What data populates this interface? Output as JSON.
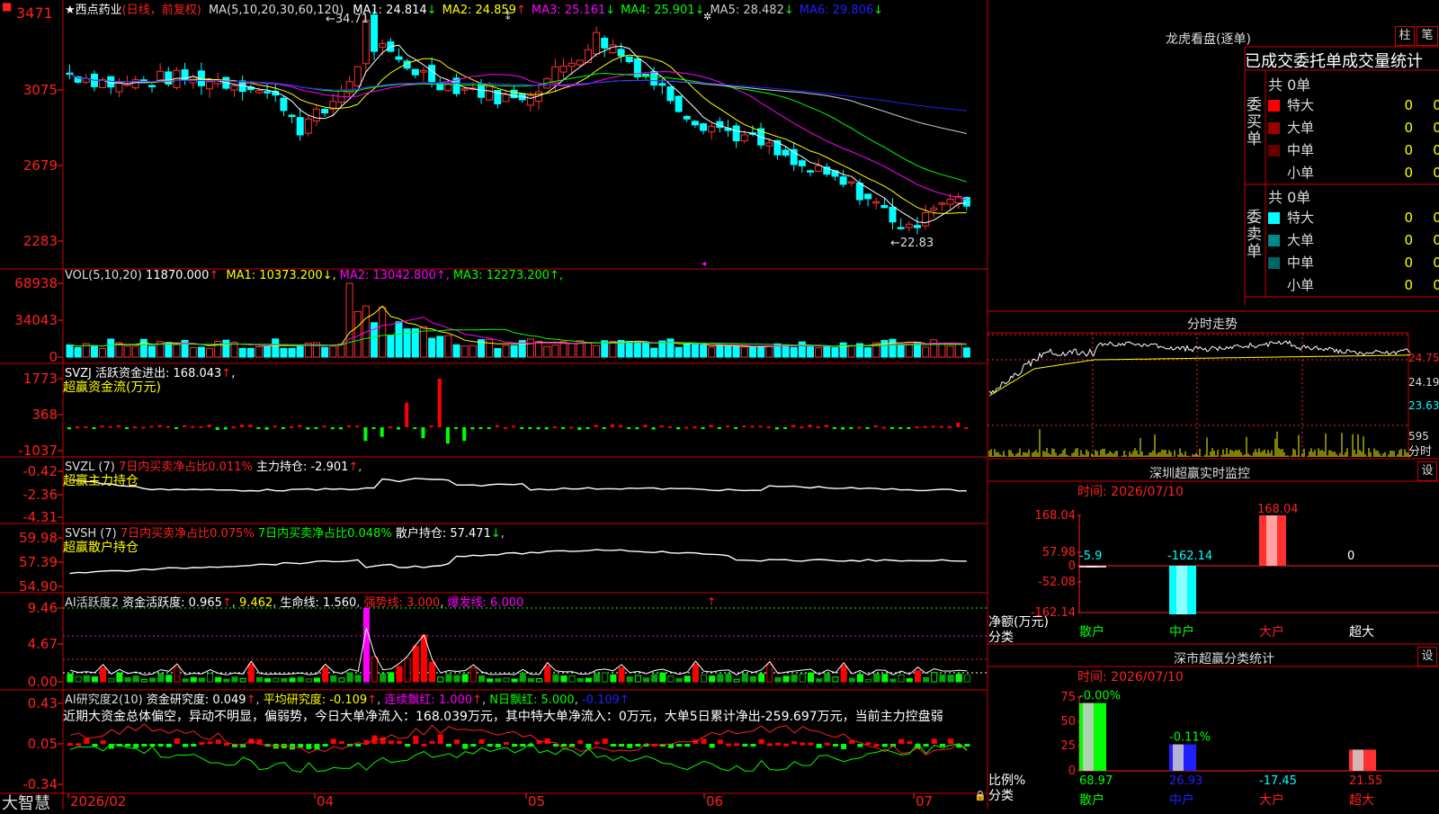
{
  "stock": {
    "name": "西点药业",
    "period": "(日线，前复权)",
    "ma_header": "MA(5,10,20,30,60,120)",
    "ma": [
      {
        "label": "MA1: 24.814",
        "arrow": "↓",
        "color": "#ffffff"
      },
      {
        "label": "MA2: 24.859",
        "arrow": "↑",
        "color": "#ffff00"
      },
      {
        "label": "MA3: 25.161",
        "arrow": "↓",
        "color": "#ff00ff"
      },
      {
        "label": "MA4: 25.901",
        "arrow": "↓",
        "color": "#00ff00"
      },
      {
        "label": "MA5: 28.482",
        "arrow": "↓",
        "color": "#cccccc"
      },
      {
        "label": "MA6: 29.806",
        "arrow": "↓",
        "color": "#2020ff"
      }
    ],
    "price_axis": [
      "3471",
      "3075",
      "2679",
      "2283"
    ],
    "high_label": "34.71",
    "low_label": "←22.83",
    "high_marker": "←"
  },
  "vol": {
    "header": "VOL(5,10,20)",
    "value": "11870.000",
    "ma": [
      {
        "label": "MA1: 10373.200",
        "arrow": "↓",
        "color": "#ffff00"
      },
      {
        "label": "MA2: 13042.800",
        "arrow": "↑",
        "color": "#ff00ff"
      },
      {
        "label": "MA3: 12273.200",
        "arrow": "↑",
        "color": "#00ff00"
      }
    ],
    "axis": [
      "68938",
      "34043",
      "0"
    ]
  },
  "svzj": {
    "header": "SVZJ  活跃资金进出: 168.043",
    "arrow": "↑",
    "sub": "超赢资金流(万元)",
    "axis": [
      "1773",
      "368",
      "-1037"
    ]
  },
  "svzl": {
    "name": "SVZL (7)",
    "part1": "7日内买卖净占比0.011%",
    "part2": "主力持仓: -2.901",
    "arrow": "↑",
    "sub": "超赢主力持仓",
    "axis": [
      "-0.42",
      "-2.36",
      "-4.31"
    ]
  },
  "svsh": {
    "name": "SVSH (7)",
    "part1": "7日内买卖净占比0.075%",
    "part2": "7日内买卖净占比0.048%",
    "part3": "散户持仓: 57.471",
    "arrow": "↓",
    "sub": "超赢散户持仓",
    "axis": [
      "59.98",
      "57.39",
      "54.90"
    ]
  },
  "ai1": {
    "name": "AI活跃度2",
    "t1": "资金活跃度: 0.965",
    "t2": "9.462",
    "t3": "生命线: 1.560",
    "t4": "强势线: 3.000",
    "t5": "爆发线: 6.000",
    "axis": [
      "9.46",
      "4.67",
      "0.00"
    ]
  },
  "ai2": {
    "name": "AI研究度2(10)",
    "t1": "资金研究度: 0.049",
    "t2": "平均研究度: -0.109",
    "t3": "连续飘红: 1.000",
    "t4": "N日飘红: 5.000",
    "t5": "-0.109",
    "comment": "近期大资金总体偏空，异动不明显，偏弱势，今日大单净流入：168.039万元，其中特大单净流入：0万元，大单5日累计净出-259.697万元，当前主力控盘弱",
    "axis": [
      "0.43",
      "0.05",
      "-0.34"
    ]
  },
  "dates": [
    "2026/02",
    "04",
    "05",
    "06",
    "07"
  ],
  "app_name": "大智慧",
  "right": {
    "lhb_title": "龙虎看盘(逐单)",
    "btn1": "柱",
    "btn2": "笔",
    "order_title": "已成交委托单成交量统计",
    "buy_label": "委买单",
    "sell_label": "委卖单",
    "buy_total": "共 0单",
    "sell_total": "共 0单",
    "buy_rows": [
      {
        "name": "特大",
        "val": "0",
        "pct": "0%",
        "color": "#ff0000"
      },
      {
        "name": "大单",
        "val": "0",
        "pct": "0%",
        "color": "#990000"
      },
      {
        "name": "中单",
        "val": "0",
        "pct": "0%",
        "color": "#660000"
      },
      {
        "name": "小单",
        "val": "0",
        "pct": "0%",
        "color": "#000000"
      }
    ],
    "sell_rows": [
      {
        "name": "特大",
        "val": "0",
        "pct": "0%",
        "color": "#00ffff"
      },
      {
        "name": "大单",
        "val": "0",
        "pct": "0%",
        "color": "#008888"
      },
      {
        "name": "中单",
        "val": "0",
        "pct": "0%",
        "color": "#006666"
      },
      {
        "name": "小单",
        "val": "0",
        "pct": "0%",
        "color": "#000000"
      }
    ],
    "intraday_title": "分时走势",
    "intraday_axis": [
      "24.75",
      "24.19",
      "23.63",
      "595"
    ],
    "intraday_unit": "分时",
    "sz_title": "深圳超赢实时监控",
    "sz_btn": "设",
    "sz_time": "时间: 2026/07/10",
    "sz_axis": [
      "168.04",
      "57.98",
      "0",
      "-52.08",
      "-162.14"
    ],
    "sz_ylabel": "净额(万元)",
    "sz_xlabel": "分类",
    "sz_cats": [
      "散户",
      "中户",
      "大户",
      "超大"
    ],
    "sz_values": [
      -5.9,
      -162.14,
      168.04,
      0
    ],
    "sz_value_labels": [
      "-5.9",
      "-162.14",
      "168.04",
      "0"
    ],
    "cls_title": "深市超赢分类统计",
    "cls_btn": "设",
    "cls_time": "时间: 2026/07/10",
    "cls_axis": [
      "75",
      "50",
      "25",
      "0"
    ],
    "cls_ylabel": "比例%",
    "cls_xlabel": "分类",
    "cls_cats": [
      "散户",
      "中户",
      "大户",
      "超大"
    ],
    "cls_values": [
      68.97,
      26.93,
      -17.45,
      21.55
    ],
    "cls_top_labels": [
      "-0.00%",
      "-0.11%",
      "",
      ""
    ],
    "cls_bottom_labels": [
      "68.97",
      "26.93",
      "-17.45",
      "21.55"
    ]
  }
}
